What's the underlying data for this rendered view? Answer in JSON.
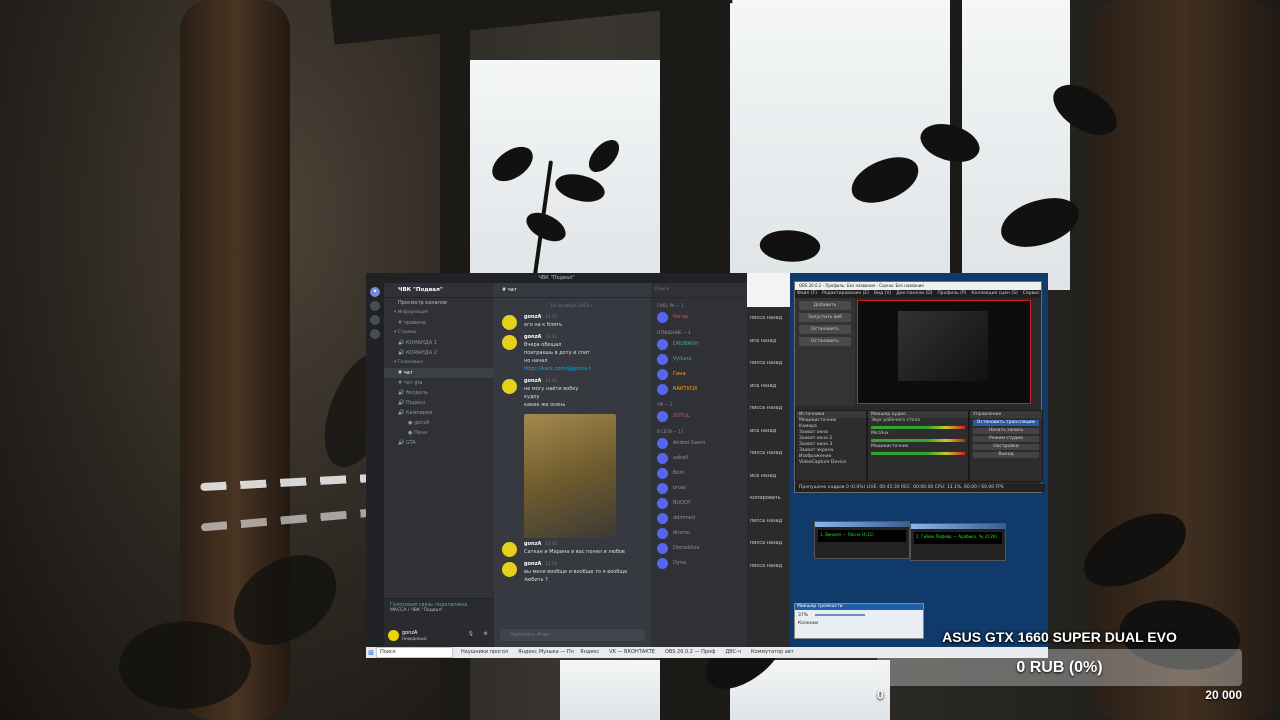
{
  "discord": {
    "title": "ЧВК \"Подвал\"",
    "server": "ЧВК \"Подвал\"",
    "browse": "Просмотр каналов",
    "channels": [
      {
        "label": "Информация",
        "type": "cat"
      },
      {
        "label": "правила",
        "type": "text"
      },
      {
        "label": "Стримы",
        "type": "cat"
      },
      {
        "label": "КОМАНДА 1",
        "type": "voice"
      },
      {
        "label": "КОМАНДА 2",
        "type": "voice"
      },
      {
        "label": "Голосовые",
        "type": "cat"
      },
      {
        "label": "чат",
        "type": "active"
      },
      {
        "label": "чат gta",
        "type": "text"
      },
      {
        "label": "болдель",
        "type": "voice"
      },
      {
        "label": "Подвал",
        "type": "voice"
      },
      {
        "label": "Кампирки",
        "type": "voice"
      },
      {
        "label": "gonzA",
        "type": "user"
      },
      {
        "label": "Пеня",
        "type": "user"
      },
      {
        "label": "GTA",
        "type": "voice"
      }
    ],
    "voice_status": "Голосовая связь подключена",
    "voice_channel": "МАССА / ЧВК \"Подвал\"",
    "username": "gonzA",
    "user_status": "Невидимый",
    "channel_header": "чат",
    "date": "10 октября 2020 г.",
    "messages": [
      {
        "author": "gonzA",
        "time": "13:35",
        "lines": [
          "его на к блять"
        ]
      },
      {
        "author": "gonzA",
        "time": "13:36",
        "lines": [
          "Вчера обещал",
          "поиграешь в доту и спит",
          "но начал"
        ],
        "link": "https://ksck.com/@gonza-t"
      },
      {
        "author": "gonzA",
        "time": "13:44",
        "lines": [
          "не могу найти вобку",
          "кудоу",
          "какие же осень"
        ]
      },
      {
        "author": "gonzA",
        "time": "13:56",
        "lines": [
          "Саткан и Марина и вас понял и любов"
        ]
      },
      {
        "author": "gonzA",
        "time": "13:58",
        "lines": [
          "вы меня вообще и вообще то я вообще",
          "любить ?"
        ]
      }
    ],
    "input_placeholder": "Написать #чат",
    "search": "Поиск",
    "member_groups": [
      {
        "label": "chill pa — 1",
        "members": [
          {
            "name": "Регор",
            "c": "red"
          }
        ]
      },
      {
        "label": "Отмщение — 4",
        "members": [
          {
            "name": "DROBASH",
            "c": "green"
          },
          {
            "name": "Vylluna",
            "c": "green"
          },
          {
            "name": "Гина",
            "c": "yellow"
          },
          {
            "name": "КАКТУСИ",
            "c": "yellow"
          }
        ]
      },
      {
        "label": "Vip — 1",
        "members": [
          {
            "name": "SOTUL",
            "c": "red"
          }
        ]
      },
      {
        "label": "В сети — 17",
        "members": [
          {
            "name": "Andrei Gasrn",
            "c": ""
          },
          {
            "name": "axbell",
            "c": ""
          },
          {
            "name": "Boni",
            "c": ""
          },
          {
            "name": "broai",
            "c": ""
          },
          {
            "name": "BUDDY",
            "c": ""
          },
          {
            "name": "ddmined",
            "c": ""
          },
          {
            "name": "dnsmo",
            "c": ""
          },
          {
            "name": "Domekilov",
            "c": ""
          },
          {
            "name": "Dyno",
            "c": ""
          }
        ]
      }
    ]
  },
  "browser": {
    "rows": [
      "писса назад",
      "иса назад",
      "писса назад",
      "иса назад",
      "писса назад",
      "иса назад",
      "писса назад",
      "иса назад",
      "копировать",
      "писса назад",
      "писса назад",
      "писса назад"
    ]
  },
  "obs": {
    "title": "OBS 26.0.2 - Профиль: Без названия - Сцены: Без названия",
    "menu": [
      "Файл (F)",
      "Редактирование (E)",
      "Вид (V)",
      "Док-панели (D)",
      "Профиль (P)",
      "Коллекция сцен (S)",
      "Сервис (T)"
    ],
    "left_buttons": [
      "Добавить",
      "Запустить веб",
      "Остановить",
      "Остановить"
    ],
    "sources_header": "Источники",
    "sources": [
      "Медиаисточник",
      "Камера",
      "Захват окна",
      "Захват окна 2",
      "Захват окна 3",
      "Захват экрана",
      "Изображение",
      "VideoCapture Device"
    ],
    "mixer_header": "Микшер аудио",
    "mixer": [
      "Звук рабочего стола",
      "Mic/Aux",
      "Медиаисточник"
    ],
    "controls_header": "Управление",
    "controls": [
      "Остановить трансляцию",
      "Начать запись",
      "Режим студии",
      "Настройки",
      "Выход"
    ],
    "status": "Пропущено кадров 0 (0.0%)   LIVE: 00:45:30   REC: 00:00:00   CPU: 13.1%, 60.00 / 60.00 FPS"
  },
  "winamp": {
    "a": "1. Винамп — Песня (4:21)",
    "b": "2. Гийом Лефевр — Арабика, Чу (4:26)"
  },
  "volume": {
    "title": "Микшер громкости",
    "value": "37%",
    "name": "Колонки"
  },
  "taskbar": {
    "search": "Поиск",
    "items": [
      "Наушники прогол",
      "Яндекс.Музыка — Пл",
      "Яндекс",
      "VK — ВКОНТАКТЕ",
      "OBS 26.0.2 — Проф",
      "ДВС-ч",
      "Коммутатор авт"
    ]
  },
  "goal": {
    "title": "ASUS GTX 1660 SUPER DUAL EVO",
    "amount": "0 RUB (0%)",
    "progress": 0,
    "min": "0",
    "max": "20 000"
  },
  "colors": {
    "goal_fill": "#4caf50",
    "discord_bg": "#36393f",
    "accent": "#5865f2"
  }
}
